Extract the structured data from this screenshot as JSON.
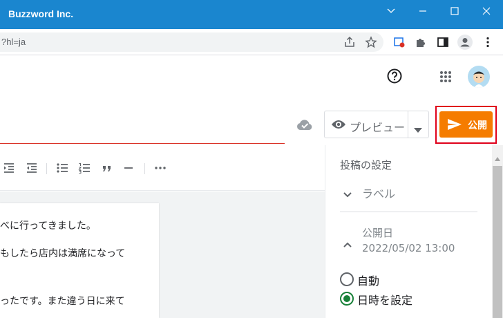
{
  "window": {
    "title": "Buzzword Inc."
  },
  "browser": {
    "url": "?hl=ja"
  },
  "post": {
    "preview_label": "プレビュー",
    "publish_label": "公開"
  },
  "editor": {
    "lines": [
      "べに行ってきました。",
      "もしたら店内は満席になって",
      "ったです。また違う日に来て"
    ]
  },
  "settings": {
    "heading": "投稿の設定",
    "label_section": "ラベル",
    "publish_date_section": "公開日",
    "publish_date_value": "2022/05/02 13:00",
    "options": [
      "自動",
      "日時を設定"
    ],
    "selected_option": "日時を設定"
  },
  "colors": {
    "titlebar": "#1a86cf",
    "publish": "#f57c00",
    "highlight": "#e0001a",
    "radio": "#188038"
  }
}
